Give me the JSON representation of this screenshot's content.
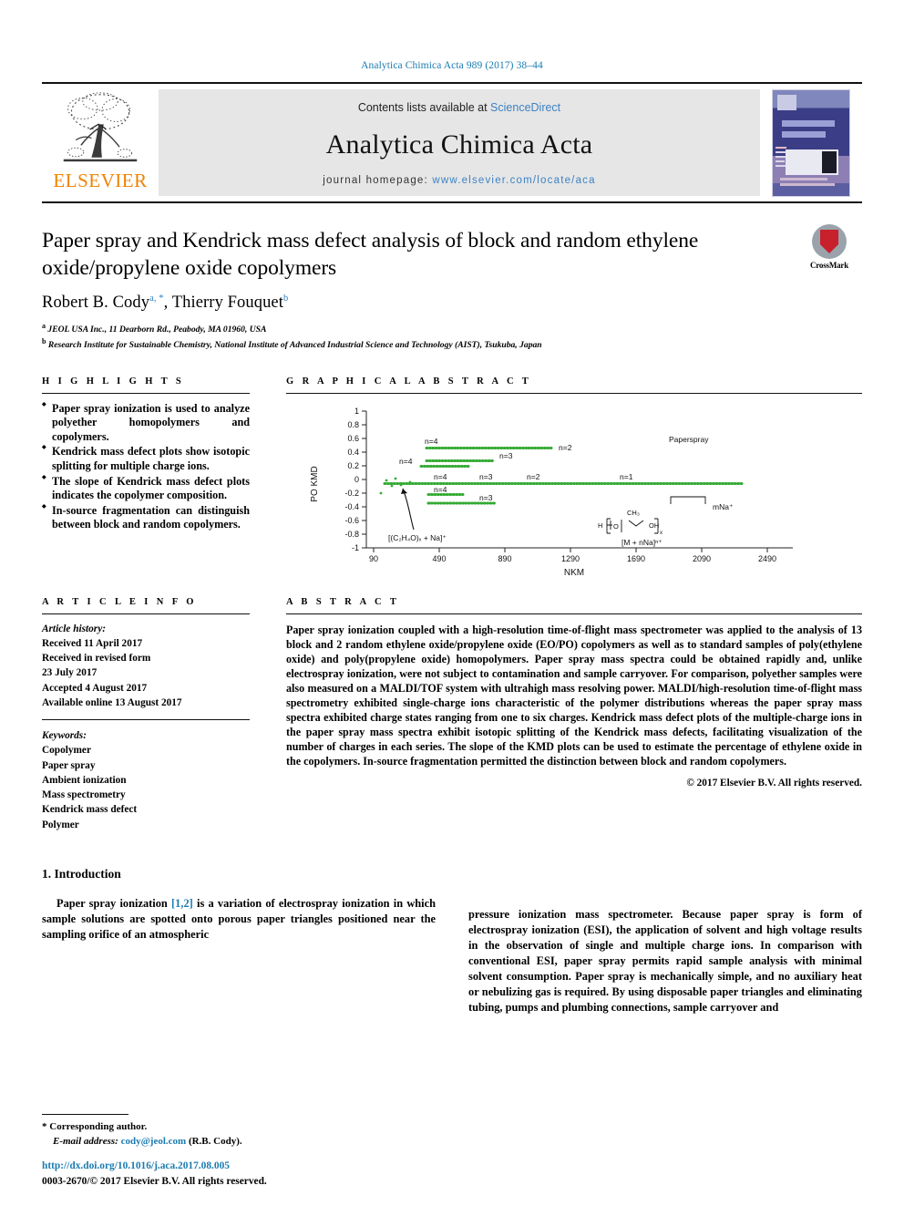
{
  "running_head": "Analytica Chimica Acta 989 (2017) 38–44",
  "masthead": {
    "contents_prefix": "Contents lists available at ",
    "sciencedirect": "ScienceDirect",
    "journal_name": "Analytica Chimica Acta",
    "homepage_prefix": "journal homepage: ",
    "homepage_url": "www.elsevier.com/locate/aca",
    "publisher": "ELSEVIER",
    "logo_icon": "elsevier-tree-logo",
    "cover_icon": "journal-cover-thumbnail",
    "link_color": "#3c82c4",
    "brand_color": "#ef8200"
  },
  "article": {
    "title": "Paper spray and Kendrick mass defect analysis of block and random ethylene oxide/propylene oxide copolymers",
    "authors_plain": "Robert B. Cody",
    "author1": "Robert B. Cody",
    "author1_marks": "a, *",
    "author2": "Thierry Fouquet",
    "author2_marks": "b",
    "affiliation_a_mark": "a",
    "affiliation_a": "JEOL USA Inc., 11 Dearborn Rd., Peabody, MA 01960, USA",
    "affiliation_b_mark": "b",
    "affiliation_b": "Research Institute for Sustainable Chemistry, National Institute of Advanced Industrial Science and Technology (AIST), Tsukuba, Japan",
    "crossmark_label": "CrossMark",
    "crossmark_icon": "crossmark-badge-icon"
  },
  "highlights": {
    "heading": "H I G H L I G H T S",
    "items": [
      "Paper spray ionization is used to analyze polyether homopolymers and copolymers.",
      "Kendrick mass defect plots show isotopic splitting for multiple charge ions.",
      "The slope of Kendrick mass defect plots indicates the copolymer composition.",
      "In-source fragmentation can distinguish between block and random copolymers."
    ]
  },
  "graphical_abstract": {
    "heading": "G R A P H I C A L   A B S T R A C T"
  },
  "article_info": {
    "heading": "A R T I C L E   I N F O",
    "history_label": "Article history:",
    "history": [
      "Received 11 April 2017",
      "Received in revised form",
      "23 July 2017",
      "Accepted 4 August 2017",
      "Available online 13 August 2017"
    ],
    "keywords_label": "Keywords:",
    "keywords": [
      "Copolymer",
      "Paper spray",
      "Ambient ionization",
      "Mass spectrometry",
      "Kendrick mass defect",
      "Polymer"
    ]
  },
  "abstract": {
    "heading": "A B S T R A C T",
    "text": "Paper spray ionization coupled with a high-resolution time-of-flight mass spectrometer was applied to the analysis of 13 block and 2 random ethylene oxide/propylene oxide (EO/PO) copolymers as well as to standard samples of poly(ethylene oxide) and poly(propylene oxide) homopolymers. Paper spray mass spectra could be obtained rapidly and, unlike electrospray ionization, were not subject to contamination and sample carryover. For comparison, polyether samples were also measured on a MALDI/TOF system with ultrahigh mass resolving power. MALDI/high-resolution time-of-flight mass spectrometry exhibited single-charge ions characteristic of the polymer distributions whereas the paper spray mass spectra exhibited charge states ranging from one to six charges. Kendrick mass defect plots of the multiple-charge ions in the paper spray mass spectra exhibit isotopic splitting of the Kendrick mass defects, facilitating visualization of the number of charges in each series. The slope of the KMD plots can be used to estimate the percentage of ethylene oxide in the copolymers. In-source fragmentation permitted the distinction between block and random copolymers.",
    "copyright": "© 2017 Elsevier B.V. All rights reserved."
  },
  "body": {
    "section_number_title": "1. Introduction",
    "left_paragraph_prefix": "Paper spray ionization ",
    "left_paragraph_ref": "[1,2]",
    "left_paragraph_suffix": " is a variation of electrospray ionization in which sample solutions are spotted onto porous paper triangles positioned near the sampling orifice of an atmospheric",
    "right_paragraph": "pressure ionization mass spectrometer. Because paper spray is form of electrospray ionization (ESI), the application of solvent and high voltage results in the observation of single and multiple charge ions. In comparison with conventional ESI, paper spray permits rapid sample analysis with minimal solvent consumption. Paper spray is mechanically simple, and no auxiliary heat or nebulizing gas is required. By using disposable paper triangles and eliminating tubing, pumps and plumbing connections, sample carryover and"
  },
  "footer": {
    "corresponding_marker": "*",
    "corresponding_label": "Corresponding author.",
    "email_label": "E-mail address:",
    "email": "cody@jeol.com",
    "email_owner": "(R.B. Cody).",
    "doi": "http://dx.doi.org/10.1016/j.aca.2017.08.005",
    "issn_line": "0003-2670/© 2017 Elsevier B.V. All rights reserved."
  },
  "chart_data": {
    "type": "scatter",
    "title": "",
    "xlabel": "NKM",
    "ylabel": "PO KMD",
    "xlim": [
      90,
      2690
    ],
    "ylim": [
      -1,
      1
    ],
    "xticks": [
      90,
      490,
      890,
      1290,
      1690,
      2090,
      2490
    ],
    "yticks": [
      -1,
      -0.8,
      -0.6,
      -0.4,
      -0.2,
      0,
      0.2,
      0.4,
      0.6,
      0.8,
      1
    ],
    "grid": false,
    "legend_position": "none",
    "series_color": "#33aa33",
    "annotations": [
      {
        "text": "Paperspray",
        "x": 1790,
        "y": 0.66
      },
      {
        "text": "n=4",
        "x": 430,
        "y": 0.57
      },
      {
        "text": "n=2",
        "x": 1240,
        "y": 0.5
      },
      {
        "text": "n=3",
        "x": 900,
        "y": 0.3
      },
      {
        "text": "n=4",
        "x": 330,
        "y": 0.3
      },
      {
        "text": "n=4",
        "x": 330,
        "y": 0.22
      },
      {
        "text": "n=4",
        "x": 520,
        "y": 0.07
      },
      {
        "text": "n=3",
        "x": 790,
        "y": 0.07
      },
      {
        "text": "n=2",
        "x": 1070,
        "y": 0.07
      },
      {
        "text": "n=1",
        "x": 1660,
        "y": 0.07
      },
      {
        "text": "n=4",
        "x": 430,
        "y": -0.18
      },
      {
        "text": "n=3",
        "x": 700,
        "y": -0.3
      },
      {
        "text": "[(C₂H₄O)ₓ + Na]⁺",
        "x": 330,
        "y": -0.82
      },
      {
        "text": "[M + nNa]ⁿ⁺",
        "x": 1690,
        "y": -0.86
      },
      {
        "text": "mNa⁺",
        "x": 2190,
        "y": -0.38
      }
    ],
    "structure_labels": [
      "H",
      "O",
      "CH₃",
      "OH",
      "x"
    ],
    "series": [
      {
        "name": "n=2 upper band",
        "kmd": 0.46,
        "x_start": 400,
        "x_end": 1180
      },
      {
        "name": "n=3 band 0.27",
        "kmd": 0.27,
        "x_start": 400,
        "x_end": 840
      },
      {
        "name": "n=4 band 0.20",
        "kmd": 0.2,
        "x_start": 370,
        "x_end": 670
      },
      {
        "name": "main n=1..4 band",
        "kmd": -0.05,
        "x_start": 120,
        "x_end": 2300
      },
      {
        "name": "n=4 band -0.22",
        "kmd": -0.22,
        "x_start": 400,
        "x_end": 600
      },
      {
        "name": "n=3 band -0.35",
        "kmd": -0.35,
        "x_start": 400,
        "x_end": 830
      }
    ]
  }
}
